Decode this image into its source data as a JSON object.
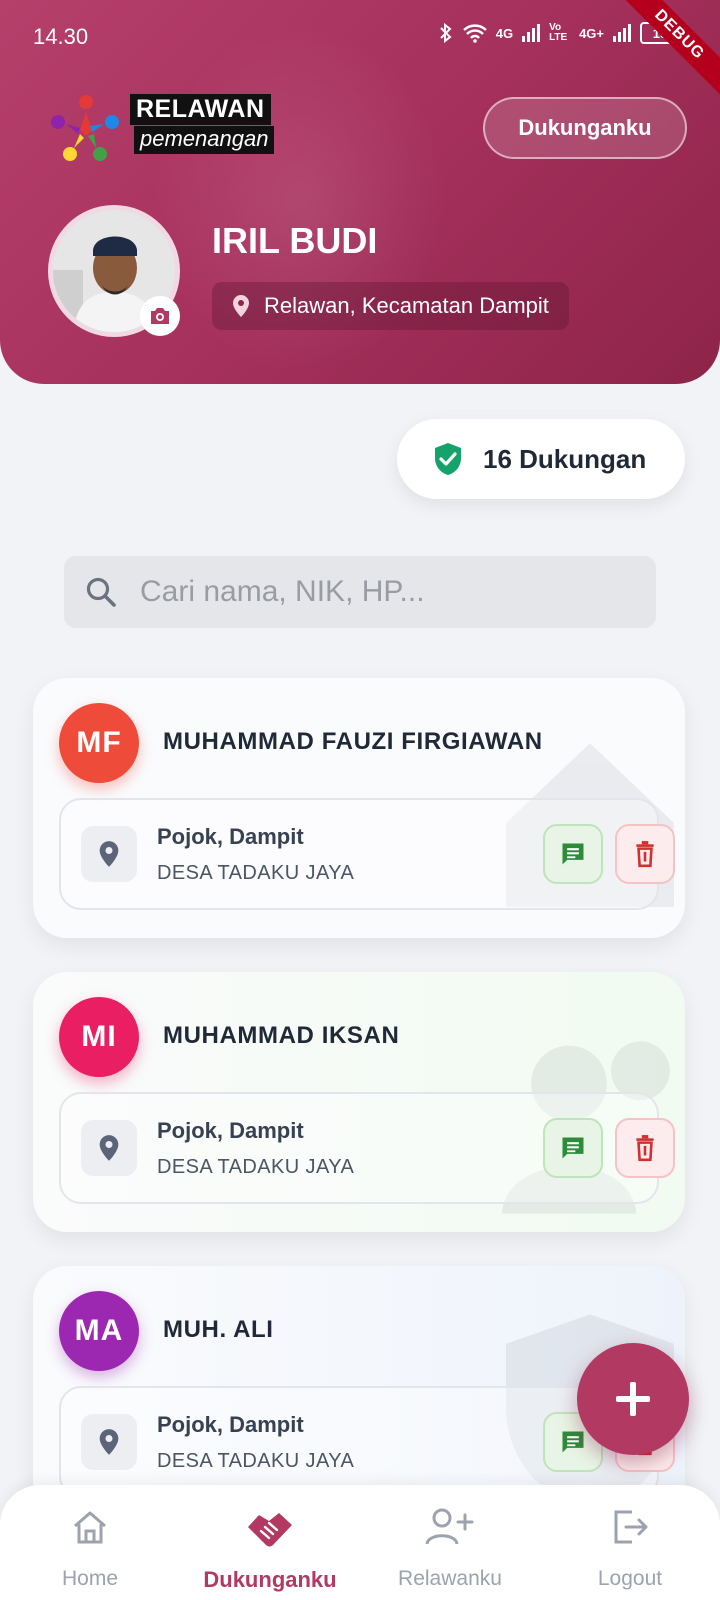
{
  "status_bar": {
    "time": "14.30",
    "battery": "15",
    "network_labels": [
      "4G",
      "Vo LTE",
      "4G+"
    ]
  },
  "debug_ribbon": "DEBUG",
  "header": {
    "logo_line1": "RELAWAN",
    "logo_line2": "pemenangan",
    "dukungan_button": "Dukunganku",
    "user_name": "IRIL BUDI",
    "role_location": "Relawan, Kecamatan Dampit",
    "brand_color": "#b23a62"
  },
  "summary": {
    "count_label": "16 Dukungan",
    "icon": "shield-check-icon"
  },
  "search": {
    "placeholder": "Cari nama, NIK, HP...",
    "value": ""
  },
  "supporters": [
    {
      "initials": "MF",
      "name": "MUHAMMAD FAUZI FIRGIAWAN",
      "location": "Pojok, Dampit",
      "village": "DESA TADAKU JAYA",
      "avatar_color": "#ef4b3a"
    },
    {
      "initials": "MI",
      "name": "MUHAMMAD IKSAN",
      "location": "Pojok, Dampit",
      "village": "DESA TADAKU JAYA",
      "avatar_color": "#e91e63"
    },
    {
      "initials": "MA",
      "name": "MUH. ALI",
      "location": "Pojok, Dampit",
      "village": "DESA TADAKU JAYA",
      "avatar_color": "#9c27b0"
    }
  ],
  "bottom_nav": [
    {
      "label": "Home",
      "icon": "home-icon",
      "active": false
    },
    {
      "label": "Dukunganku",
      "icon": "handshake-icon",
      "active": true
    },
    {
      "label": "Relawanku",
      "icon": "add-person-icon",
      "active": false
    },
    {
      "label": "Logout",
      "icon": "logout-icon",
      "active": false
    }
  ]
}
